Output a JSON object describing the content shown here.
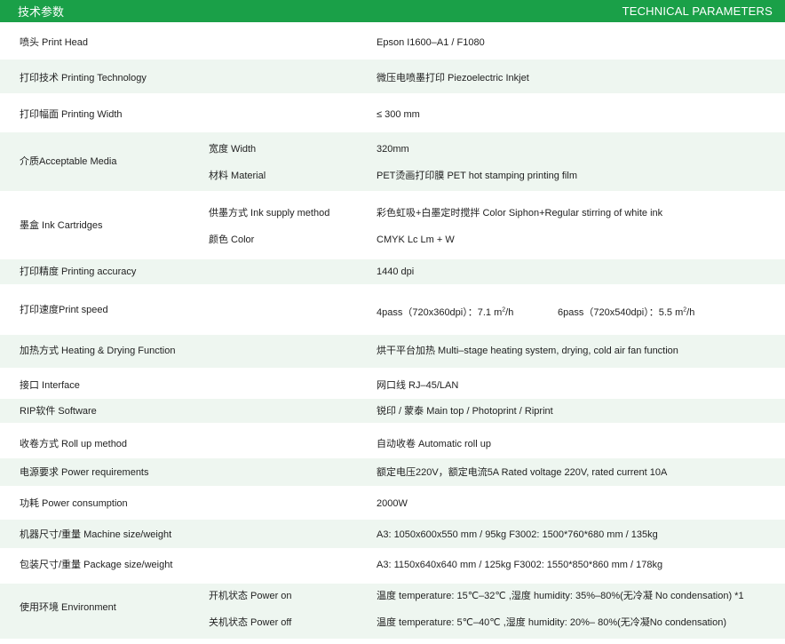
{
  "header": {
    "title_cn": "技术参数",
    "title_en": "TECHNICAL PARAMETERS"
  },
  "rows": {
    "print_head": {
      "label": "喷头 Print Head",
      "value": "Epson I1600–A1  /  F1080"
    },
    "printing_tech": {
      "label": "打印技术 Printing Technology",
      "value": "微压电喷墨打印 Piezoelectric Inkjet"
    },
    "printing_width": {
      "label": "打印幅面 Printing Width",
      "value": "≤ 300 mm"
    },
    "media": {
      "label": "介质Acceptable Media",
      "width_label": "宽度 Width",
      "width_value": "320mm",
      "material_label": "材料 Material",
      "material_value": "PET烫画打印膜 PET hot stamping printing film"
    },
    "ink": {
      "label": "墨盒 Ink Cartridges",
      "supply_label": "供墨方式 Ink supply method",
      "supply_value": "彩色虹吸+白墨定时搅拌 Color Siphon+Regular stirring of white ink",
      "color_label": "颜色 Color",
      "color_value": "CMYK Lc Lm + W"
    },
    "accuracy": {
      "label": "打印精度 Printing accuracy",
      "value": "1440 dpi"
    },
    "speed": {
      "label": "打印速度Print speed",
      "value_1_pre": "4pass（720x360dpi）：7.1 m",
      "value_1_post": "/h",
      "value_2_pre": "6pass（720x540dpi）：5.5 m",
      "value_2_post": "/h",
      "sup": "2"
    },
    "heating": {
      "label": "加热方式 Heating & Drying Function",
      "value": "烘干平台加热 Multi–stage heating system, drying, cold air fan function"
    },
    "interface": {
      "label": "接口 Interface",
      "value": "网口线 RJ–45/LAN"
    },
    "rip": {
      "label": "RIP软件 Software",
      "value": "锐印 / 蒙泰   Main top / Photoprint / Riprint"
    },
    "roll": {
      "label": "收卷方式 Roll up method",
      "value": "自动收卷 Automatic roll up"
    },
    "power_req": {
      "label": "电源要求 Power requirements",
      "value": "额定电压220V，额定电流5A  Rated voltage 220V, rated current 10A"
    },
    "power_cons": {
      "label": "功耗 Power consumption",
      "value": "2000W"
    },
    "machine_size": {
      "label": "机器尺寸/重量 Machine size/weight",
      "value": "A3: 1050x600x550 mm / 95kg    F3002: 1500*760*680 mm / 135kg"
    },
    "package_size": {
      "label": "包装尺寸/重量 Package size/weight",
      "value": "A3: 1150x640x640 mm / 125kg    F3002: 1550*850*860 mm / 178kg"
    },
    "environment": {
      "label": "使用环境 Environment",
      "on_label": "开机状态 Power on",
      "on_value": "温度 temperature: 15℃–32℃ ,湿度 humidity: 35%–80%(无冷凝 No condensation) *1",
      "off_label": "关机状态 Power off",
      "off_value": "温度 temperature: 5℃–40℃ ,湿度 humidity: 20%– 80%(无冷凝No condensation)"
    }
  }
}
